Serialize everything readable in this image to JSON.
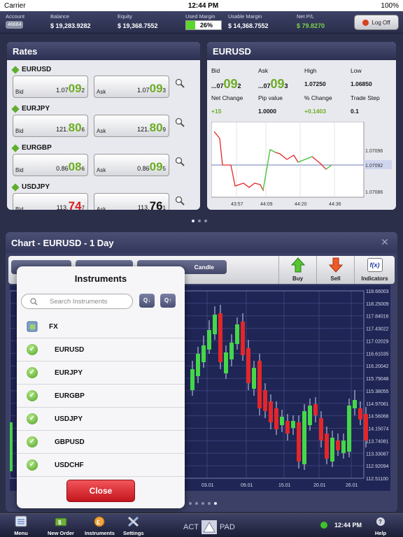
{
  "status": {
    "carrier": "Carrier",
    "time": "12:44 PM",
    "battery": "100%"
  },
  "account": {
    "account_label": "Account",
    "account_value": "46664",
    "balance_label": "Balance",
    "balance_value": "$ 19,283.9282",
    "equity_label": "Equity",
    "equity_value": "$ 19,368.7552",
    "used_margin_label": "Used Margin",
    "used_margin_value": "26%",
    "used_margin_fraction": 0.26,
    "usable_margin_label": "Usable Margin",
    "usable_margin_value": "$ 14,368.7552",
    "netpl_label": "Net P/L",
    "netpl_value": "$ 79.8270",
    "logoff_label": "Log Off"
  },
  "rates": {
    "title": "Rates",
    "items": [
      {
        "symbol": "EURUSD",
        "bid_label": "Bid",
        "bid_pre": "1.07",
        "bid_big": "09",
        "bid_post": "2",
        "ask_label": "Ask",
        "ask_pre": "1.07",
        "ask_big": "09",
        "ask_post": "3"
      },
      {
        "symbol": "EURJPY",
        "bid_label": "Bid",
        "bid_pre": "121.",
        "bid_big": "80",
        "bid_post": "6",
        "ask_label": "Ask",
        "ask_pre": "121.",
        "ask_big": "80",
        "ask_post": "9"
      },
      {
        "symbol": "EURGBP",
        "bid_label": "Bid",
        "bid_pre": "0.86",
        "bid_big": "08",
        "bid_post": "6",
        "ask_label": "Ask",
        "ask_pre": "0.86",
        "ask_big": "09",
        "ask_post": "5"
      },
      {
        "symbol": "USDJPY",
        "bid_label": "Bid",
        "bid_pre": "113.",
        "bid_big": "74",
        "bid_post": "7",
        "ask_label": "Ask",
        "ask_pre": "113.",
        "ask_big": "76",
        "ask_post": "1"
      }
    ]
  },
  "eurusd": {
    "title": "EURUSD",
    "bid_label": "Bid",
    "bid_pre": "...07",
    "bid_big": "09",
    "bid_post": "2",
    "ask_label": "Ask",
    "ask_pre": "...07",
    "ask_big": "09",
    "ask_post": "3",
    "high_label": "High",
    "high_value": "1.07250",
    "low_label": "Low",
    "low_value": "1.06850",
    "net_change_label": "Net Change",
    "net_change_value": "+15",
    "pip_label": "Pip value",
    "pip_value": "1.0000",
    "pct_label": "% Change",
    "pct_value": "+0.1403",
    "trade_step_label": "Trade Step",
    "trade_step_value": "0.1",
    "y_ticks": [
      "1.07096",
      "1.07092",
      "1.07086"
    ],
    "x_ticks": [
      "43:57",
      "44:09",
      "44:20",
      "44:36"
    ]
  },
  "chart_panel": {
    "title": "Chart - EURUSD - 1 Day",
    "candle_label": "Candle",
    "buy_label": "Buy",
    "sell_label": "Sell",
    "indicators_label": "Indicators",
    "y_ticks": [
      "118.66003",
      "118.25009",
      "117.84016",
      "117.43022",
      "117.02029",
      "116.61035",
      "116.20042",
      "115.79048",
      "115.38055",
      "114.97061",
      "114.56068",
      "114.15074",
      "113.74081",
      "113.33087",
      "112.92094",
      "112.51100"
    ],
    "x_ticks": [
      "03.01",
      "09.01",
      "15.01",
      "20.01",
      "26.01"
    ]
  },
  "instruments": {
    "title": "Instruments",
    "search_placeholder": "Search Instruments",
    "group": "FX",
    "items": [
      "EURUSD",
      "EURJPY",
      "EURGBP",
      "USDJPY",
      "GBPUSD",
      "USDCHF"
    ],
    "close_label": "Close"
  },
  "nav": {
    "menu": "Menu",
    "new_order": "New Order",
    "instruments": "Instruments",
    "settings": "Settings",
    "brand_left": "ACT",
    "brand_right": "PAD",
    "clock": "12:44 PM",
    "help": "Help"
  },
  "colors": {
    "bull": "#45d64a",
    "bear": "#e3262a",
    "accent": "#6cae23"
  }
}
